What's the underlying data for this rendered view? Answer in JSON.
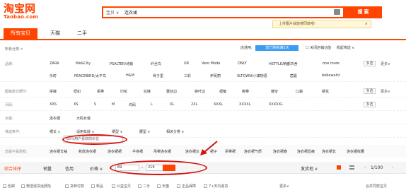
{
  "logo": {
    "cn": "淘宝网",
    "en": "Taobao.com"
  },
  "search": {
    "category": "宝贝 ∨",
    "query": "连衣裙",
    "button": "搜 索"
  },
  "tip": {
    "text": "上传图片就能搜同款啦!",
    "close": "×"
  },
  "tabs": [
    "所有宝贝",
    "天猫",
    "二手"
  ],
  "breadcrumb": "所有分类 >",
  "store_bar": {
    "label": "店通用:",
    "button": "您已购物满5次",
    "closed": "关闭店铺功能",
    "collapse": "收起筛选 ∨"
  },
  "rows": [
    {
      "label": "品牌:",
      "values": [
        "ZARA",
        "Me&City",
        "PSALTER/诗篇",
        "纤丝鸟",
        "UR",
        "Vero Moda",
        "ONLY",
        "HSTYLE/韩都衣舍",
        "one more"
      ],
      "values2": [
        "乐町",
        "PEACEBIRD/太平鸟",
        "H&M",
        "骨子里",
        "三彩",
        "伊芙丽",
        "SLTOWN/小镇物语",
        "茵曼",
        "bobowaltz"
      ],
      "multi": "多选",
      "more": "更多∨"
    },
    {
      "label": "服装款式细节:",
      "values": [
        "拼接",
        "纽扣",
        "系带",
        "印花",
        "拉链",
        "蕾丝边",
        "荷叶边",
        "褶皱",
        "绑带",
        "镂空",
        "口袋",
        "绣花"
      ],
      "multi": "多选",
      "more": "更多∨"
    },
    {
      "label": "尺码:",
      "values": [
        "XXS",
        "XS",
        "S",
        "M",
        "均码",
        "L",
        "XL",
        "2XL",
        "XXXL",
        "XXXXL",
        "XXXXXL"
      ],
      "multi": "多选"
    },
    {
      "label": "女装:",
      "values": [
        "连衣裙",
        "大码女装"
      ]
    },
    {
      "label": "筛选条件:",
      "values": [
        "裙长 ∨",
        "适用年龄 ∨",
        "裙型 ∨",
        "腰型 ∨",
        "相关分类 ∨"
      ]
    }
  ],
  "related": {
    "label": "您是不是想找:",
    "items": [
      "连衣裙长袖",
      "新款连衣裙",
      "连衣裙裙",
      "半身裙",
      "吊带连衣裙",
      "连衣裙女",
      "裙子",
      "吊带裙",
      "连衣裙气质",
      "连衣裙春",
      "连衣裙显瘦",
      "连衣裙长",
      "连衣裙收腰"
    ]
  },
  "hint": "60%用户喜欢的价位",
  "sortbar": {
    "items": [
      "综合排序",
      "销量",
      "信用",
      "价格 ∨"
    ],
    "price_min": "69",
    "price_max": "219",
    "ship": "发货地 ∨",
    "page": "1/100"
  },
  "filters": [
    "包邮",
    "赠送退货运费险",
    "货到付款",
    "新品",
    "公益宝贝",
    "二手",
    "天猫",
    "正品保障",
    "7+天内退货",
    "更多∨"
  ],
  "filters_right": "合并同款宝贝",
  "colors": {
    "accent": "#ff4400",
    "blue": "#3c9cf2",
    "annot": "#d60d0d"
  }
}
